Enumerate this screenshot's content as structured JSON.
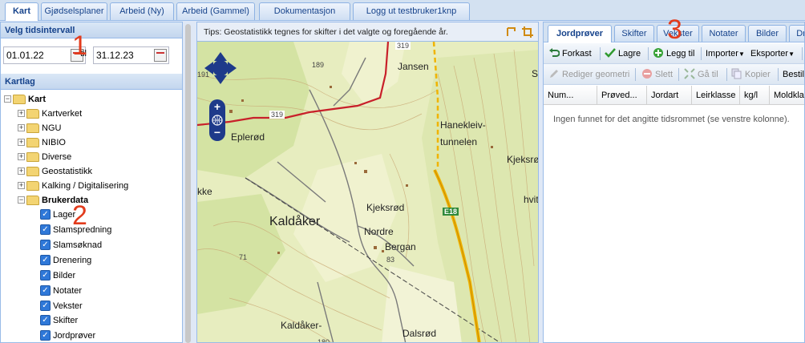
{
  "top_tabs": [
    {
      "label": "Kart",
      "active": true
    },
    {
      "label": "Gjødselsplaner"
    },
    {
      "label": "Arbeid (Ny)"
    },
    {
      "label": "Arbeid (Gammel)"
    },
    {
      "label": "Dokumentasjon"
    },
    {
      "label": "Logg ut testbruker1knp"
    }
  ],
  "left": {
    "interval_title": "Velg tidsintervall",
    "date_from": "01.01.22",
    "date_sep": "til",
    "date_to": "31.12.23",
    "layers_title": "Kartlag",
    "tree": {
      "root": "Kart",
      "groups": [
        "Kartverket",
        "NGU",
        "NIBIO",
        "Diverse",
        "Geostatistikk",
        "Kalking / Digitalisering"
      ],
      "open_group": "Brukerdata",
      "items": [
        "Lager",
        "Slamspredning",
        "Slamsøknad",
        "Drenering",
        "Bilder",
        "Notater",
        "Vekster",
        "Skifter",
        "Jordprøver"
      ]
    }
  },
  "map": {
    "tip": "Tips: Geostatistikk tegnes for skifter i det valgte og foregående år.",
    "labels": {
      "jansen": "Jansen",
      "eplerod": "Eplerød",
      "hanekleiv1": "Hanekleiv-",
      "hanekleiv2": "tunnelen",
      "kjeksrod_r": "Kjeksrø",
      "hvit": "hvit",
      "kaldaker": "Kaldåker",
      "kjeksrod": "Kjeksrød",
      "nordre": "Nordre",
      "bergan": "Bergan",
      "kke": "kke",
      "kaldaker2": "Kaldåker-",
      "dalsrod": "Dalsrød",
      "st": "St",
      "road319a": "319",
      "road319b": "319",
      "e18": "E18",
      "h189": "189",
      "h83": "83",
      "h71": "71",
      "h180": "180",
      "h191": "191"
    }
  },
  "right": {
    "tabs": [
      "Jordprøver",
      "Skifter",
      "Vekster",
      "Notater",
      "Bilder",
      "Dr"
    ],
    "toolbar1": {
      "forkast": "Forkast",
      "lagre": "Lagre",
      "legg_til": "Legg til",
      "importer": "Importer",
      "eksporter": "Eksporter"
    },
    "toolbar2": {
      "rediger": "Rediger geometri",
      "slett": "Slett",
      "ga_til": "Gå til",
      "kopier": "Kopier",
      "bestil": "Bestil"
    },
    "columns": [
      "Num...",
      "Prøved...",
      "Jordart",
      "Leirklasse",
      "kg/l",
      "Moldkla"
    ],
    "empty_text": "Ingen funnet for det angitte tidsrommet (se venstre kolonne)."
  },
  "annotations": {
    "one": "1",
    "two": "2",
    "three": "3"
  },
  "colors": {
    "accent": "#15428b",
    "annotation": "#e23b1c",
    "road_red": "#c8202a",
    "road_e18": "#f0b400"
  }
}
